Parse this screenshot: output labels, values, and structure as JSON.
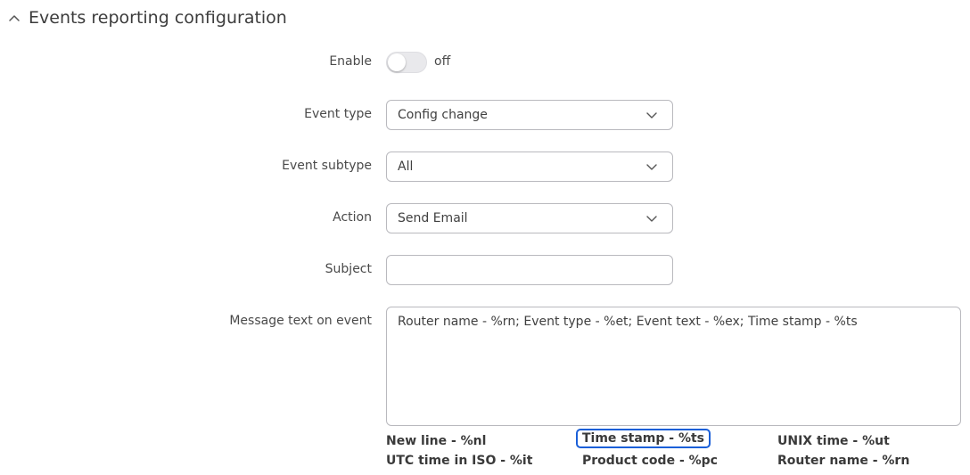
{
  "section": {
    "title": "Events reporting configuration"
  },
  "fields": {
    "enable": {
      "label": "Enable",
      "state_text": "off",
      "enabled": false
    },
    "event_type": {
      "label": "Event type",
      "value": "Config change"
    },
    "event_subtype": {
      "label": "Event subtype",
      "value": "All"
    },
    "action": {
      "label": "Action",
      "value": "Send Email"
    },
    "subject": {
      "label": "Subject",
      "value": ""
    },
    "message": {
      "label": "Message text on event",
      "value": "Router name - %rn; Event type - %et; Event text - %ex; Time stamp - %ts"
    }
  },
  "variables": [
    {
      "label": "New line - %nl"
    },
    {
      "label": "Time stamp - %ts"
    },
    {
      "label": "UNIX time - %ut"
    },
    {
      "label": "UTC time in ISO - %it"
    },
    {
      "label": "Product code - %pc"
    },
    {
      "label": "Router name - %rn"
    }
  ],
  "colors": {
    "highlight_border": "#1a5fd8",
    "toggle_off_track": "#e9e9ec",
    "input_border": "#b9b9be"
  }
}
